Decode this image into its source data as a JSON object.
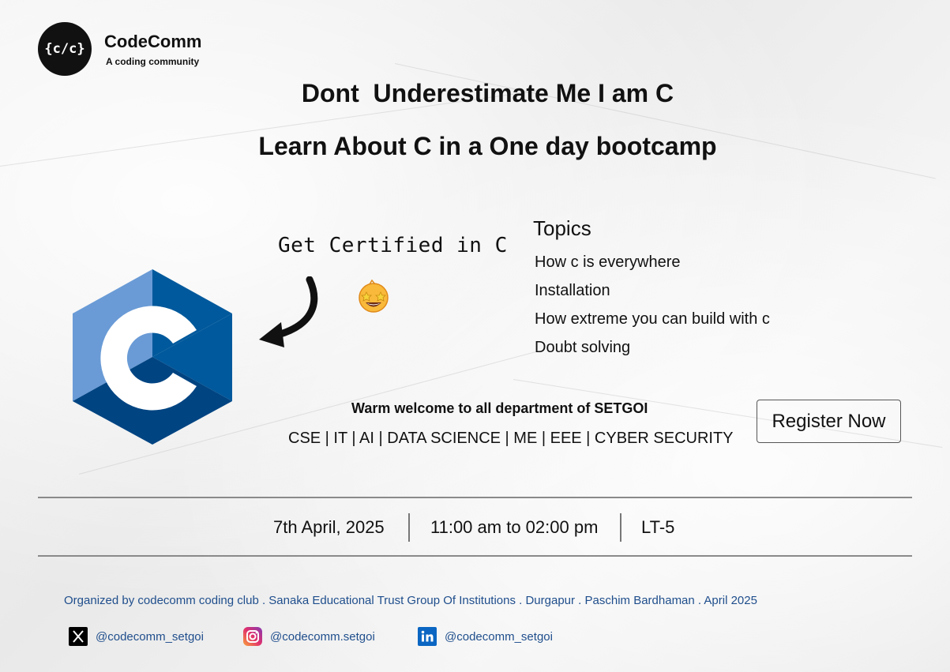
{
  "brand": {
    "logo_text": "{c/c}",
    "name": "CodeComm",
    "tagline": "A coding community"
  },
  "headline": {
    "line1": "Dont  Underestimate Me I am C",
    "line2": "Learn About C in a One day bootcamp"
  },
  "certified": "Get Certified in C",
  "topics": {
    "title": "Topics",
    "items": [
      "How c is everywhere",
      "Installation",
      "How extreme you can build with c",
      "Doubt solving"
    ]
  },
  "welcome": "Warm welcome to all department of SETGOI",
  "departments": "CSE | IT | AI | DATA SCIENCE | ME | EEE | CYBER SECURITY",
  "register_label": "Register Now",
  "event": {
    "date": "7th April, 2025",
    "time": "11:00 am to 02:00 pm",
    "venue": "LT-5"
  },
  "organizer": "Organized by codecomm coding club . Sanaka Educational Trust Group Of Institutions . Durgapur . Paschim Bardhaman . April 2025",
  "socials": [
    {
      "icon": "x-icon",
      "handle": "@codecomm_setgoi"
    },
    {
      "icon": "instagram-icon",
      "handle": "@codecomm.setgoi"
    },
    {
      "icon": "linkedin-icon",
      "handle": "@codecomm_setgoi"
    }
  ],
  "colors": {
    "c_logo_light": "#6a9bd6",
    "c_logo_mid": "#00599c",
    "c_logo_dark": "#004482",
    "link_blue": "#1f4e8c"
  }
}
